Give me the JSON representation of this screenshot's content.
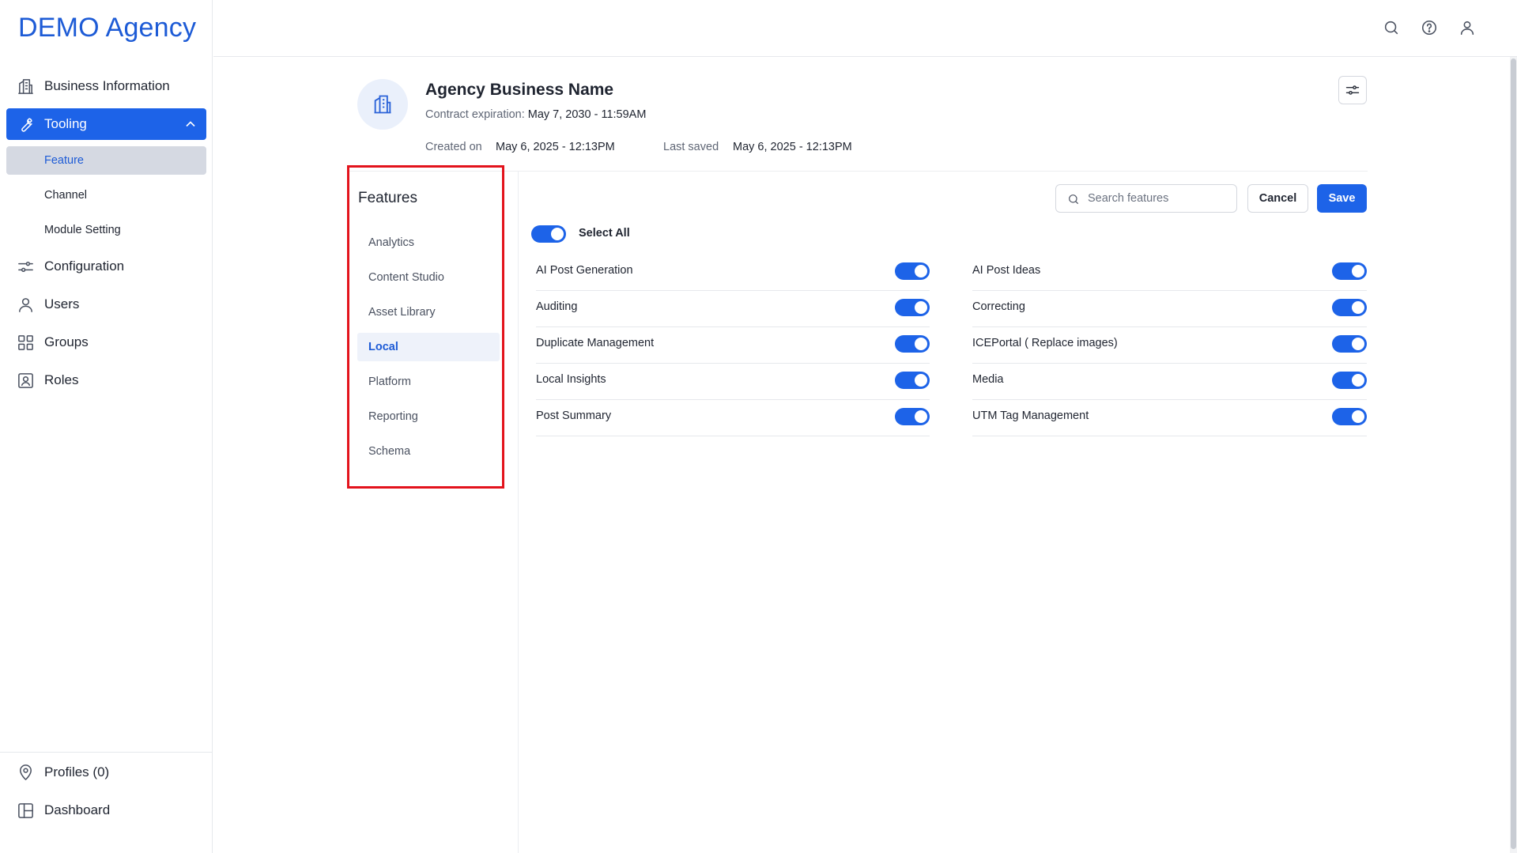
{
  "sidebar": {
    "brand": "DEMO Agency",
    "items": [
      {
        "label": "Business Information",
        "icon": "building-icon"
      },
      {
        "label": "Tooling",
        "icon": "wrench-icon"
      },
      {
        "label": "Configuration",
        "icon": "sliders-icon"
      },
      {
        "label": "Users",
        "icon": "user-icon"
      },
      {
        "label": "Groups",
        "icon": "grid-icon"
      },
      {
        "label": "Roles",
        "icon": "id-badge-icon"
      }
    ],
    "tooling_sub": [
      "Feature",
      "Channel",
      "Module Setting"
    ],
    "bottom": [
      {
        "label": "Profiles (0)",
        "icon": "map-pin-icon"
      },
      {
        "label": "Dashboard",
        "icon": "layout-icon"
      }
    ]
  },
  "header": {
    "business_name": "Agency Business Name",
    "contract_label": "Contract expiration:",
    "contract_value": "May 7, 2030 - 11:59AM",
    "created_label": "Created on",
    "created_value": "May 6, 2025 - 12:13PM",
    "saved_label": "Last saved",
    "saved_value": "May 6, 2025 - 12:13PM"
  },
  "features_panel": {
    "title": "Features",
    "categories": [
      "Analytics",
      "Content Studio",
      "Asset Library",
      "Local",
      "Platform",
      "Reporting",
      "Schema"
    ],
    "selected_category": "Local"
  },
  "toolbar": {
    "search_placeholder": "Search features",
    "cancel_label": "Cancel",
    "save_label": "Save"
  },
  "select_all": {
    "label": "Select All",
    "on": true
  },
  "features_left": [
    {
      "label": "AI Post Generation",
      "on": true
    },
    {
      "label": "Auditing",
      "on": true
    },
    {
      "label": "Duplicate Management",
      "on": true
    },
    {
      "label": "Local Insights",
      "on": true
    },
    {
      "label": "Post Summary",
      "on": true
    }
  ],
  "features_right": [
    {
      "label": "AI Post Ideas",
      "on": true
    },
    {
      "label": "Correcting",
      "on": true
    },
    {
      "label": "ICEPortal ( Replace images)",
      "on": true
    },
    {
      "label": "Media",
      "on": true
    },
    {
      "label": "UTM Tag Management",
      "on": true
    }
  ],
  "colors": {
    "accent": "#1d63e8",
    "brand": "#1d5bd6",
    "highlight_frame": "#e3131c",
    "sub_active_bg": "#d5d9e2"
  }
}
